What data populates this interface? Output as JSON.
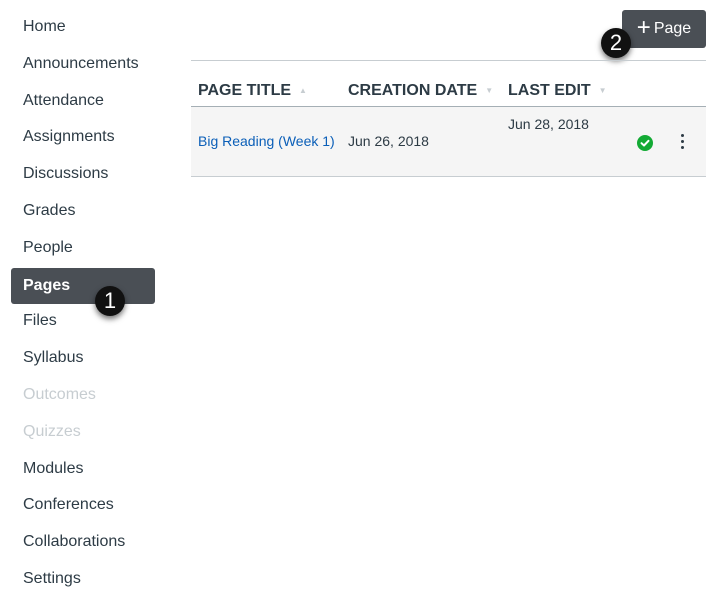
{
  "nav": {
    "items": [
      {
        "label": "Home",
        "state": "normal"
      },
      {
        "label": "Announcements",
        "state": "normal"
      },
      {
        "label": "Attendance",
        "state": "normal"
      },
      {
        "label": "Assignments",
        "state": "normal"
      },
      {
        "label": "Discussions",
        "state": "normal"
      },
      {
        "label": "Grades",
        "state": "normal"
      },
      {
        "label": "People",
        "state": "normal"
      },
      {
        "label": "Pages",
        "state": "active"
      },
      {
        "label": "Files",
        "state": "normal"
      },
      {
        "label": "Syllabus",
        "state": "normal"
      },
      {
        "label": "Outcomes",
        "state": "disabled"
      },
      {
        "label": "Quizzes",
        "state": "disabled"
      },
      {
        "label": "Modules",
        "state": "normal"
      },
      {
        "label": "Conferences",
        "state": "normal"
      },
      {
        "label": "Collaborations",
        "state": "normal"
      },
      {
        "label": "Settings",
        "state": "normal"
      }
    ]
  },
  "callouts": {
    "one": "1",
    "two": "2"
  },
  "toolbar": {
    "add_page_icon": "+",
    "add_page_label": "Page"
  },
  "table": {
    "columns": [
      {
        "label": "PAGE TITLE",
        "sort": "▲"
      },
      {
        "label": "CREATION DATE",
        "sort": "▼"
      },
      {
        "label": "LAST EDIT",
        "sort": "▼"
      }
    ],
    "rows": [
      {
        "title": "Big Reading (Week 1)",
        "created": "Jun 26, 2018",
        "last_edit": "Jun 28, 2018",
        "status": "published"
      }
    ]
  },
  "colors": {
    "active_nav": "#4a4f55",
    "link": "#0b5fb8",
    "published": "#13aa34"
  }
}
